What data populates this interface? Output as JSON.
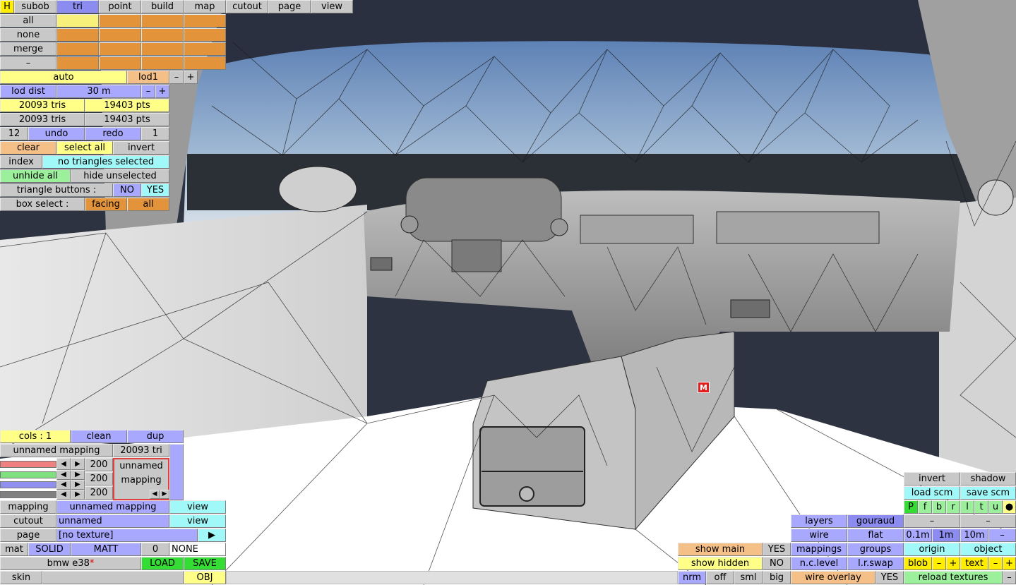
{
  "top_tabs": {
    "h": "H",
    "subob": "subob",
    "tri": "tri",
    "point": "point",
    "build": "build",
    "map": "map",
    "cutout": "cutout",
    "page": "page",
    "view": "view"
  },
  "subob_grid": {
    "all": "all",
    "none": "none",
    "merge": "merge",
    "minus": "–"
  },
  "lod": {
    "auto": "auto",
    "lod1": "lod1",
    "minus": "–",
    "plus": "+",
    "dist_label": "lod dist",
    "dist_value": "30 m"
  },
  "stats": {
    "tris1": "20093 tris",
    "pts1": "19403 pts",
    "tris2": "20093 tris",
    "pts2": "19403 pts"
  },
  "history": {
    "count": "12",
    "undo": "undo",
    "redo": "redo",
    "step": "1"
  },
  "selection": {
    "clear": "clear",
    "select_all": "select all",
    "invert": "invert",
    "index_label": "index",
    "index_value": "no triangles selected",
    "unhide_all": "unhide all",
    "hide_unselected": "hide unselected",
    "tri_buttons_label": "triangle buttons :",
    "no": "NO",
    "yes": "YES",
    "box_select_label": "box select :",
    "facing": "facing",
    "all": "all"
  },
  "mapping_panel": {
    "cols": "cols : 1",
    "clean": "clean",
    "dup": "dup",
    "mapping_name": "unnamed mapping",
    "tri_count": "20093 tri",
    "rgb": [
      "200",
      "200",
      "200"
    ],
    "preview_line1": "unnamed",
    "preview_line2": "mapping",
    "left_arrow": "◀",
    "right_arrow": "▶"
  },
  "bottom_rows": {
    "mapping_label": "mapping",
    "mapping_value": "unnamed mapping",
    "view1": "view",
    "cutout_label": "cutout",
    "cutout_value": "unnamed",
    "view2": "view",
    "page_label": "page",
    "page_value": "[no texture]",
    "page_arrow": "▶",
    "mat_label": "mat",
    "solid": "SOLID",
    "matt": "MATT",
    "mat_num": "0",
    "none": "NONE",
    "model_name": "bmw e38",
    "modified_mark": "*",
    "load": "LOAD",
    "save": "SAVE",
    "skin": "skin",
    "obj": "OBJ"
  },
  "bottom_middle": {
    "show_main": "show main",
    "show_main_val": "YES",
    "show_hidden": "show hidden",
    "show_hidden_val": "NO",
    "nrm": "nrm",
    "off": "off",
    "sml": "sml",
    "big": "big"
  },
  "render_panel": {
    "layers": "layers",
    "gouraud": "gouraud",
    "wire": "wire",
    "flat": "flat",
    "mappings": "mappings",
    "groups": "groups",
    "nc_level": "n.c.level",
    "lr_swap": "l.r.swap",
    "wire_overlay": "wire overlay",
    "wire_overlay_val": "YES"
  },
  "right_panel": {
    "invert": "invert",
    "shadow": "shadow",
    "load_scm": "load scm",
    "save_scm": "save scm",
    "views": [
      "P",
      "f",
      "b",
      "r",
      "l",
      "t",
      "u",
      "●"
    ],
    "minus1": "–",
    "minus2": "–",
    "scale_01": "0.1m",
    "scale_1": "1m",
    "scale_10": "10m",
    "minus3": "–",
    "origin": "origin",
    "object": "object",
    "blob": "blob",
    "blob_minus": "–",
    "blob_plus": "+",
    "text": "text",
    "text_minus": "–",
    "text_plus": "+",
    "reload": "reload textures",
    "reload_minus": "–"
  },
  "marker": "M",
  "colors": {
    "toolbar_gray": "#c8c8c8",
    "blue": "#a8a8ff",
    "orange": "#e3933a",
    "yellow": "#ffff88",
    "green": "#9cf09c",
    "cyan": "#a0f8f8",
    "bright_green": "#33dd33"
  }
}
